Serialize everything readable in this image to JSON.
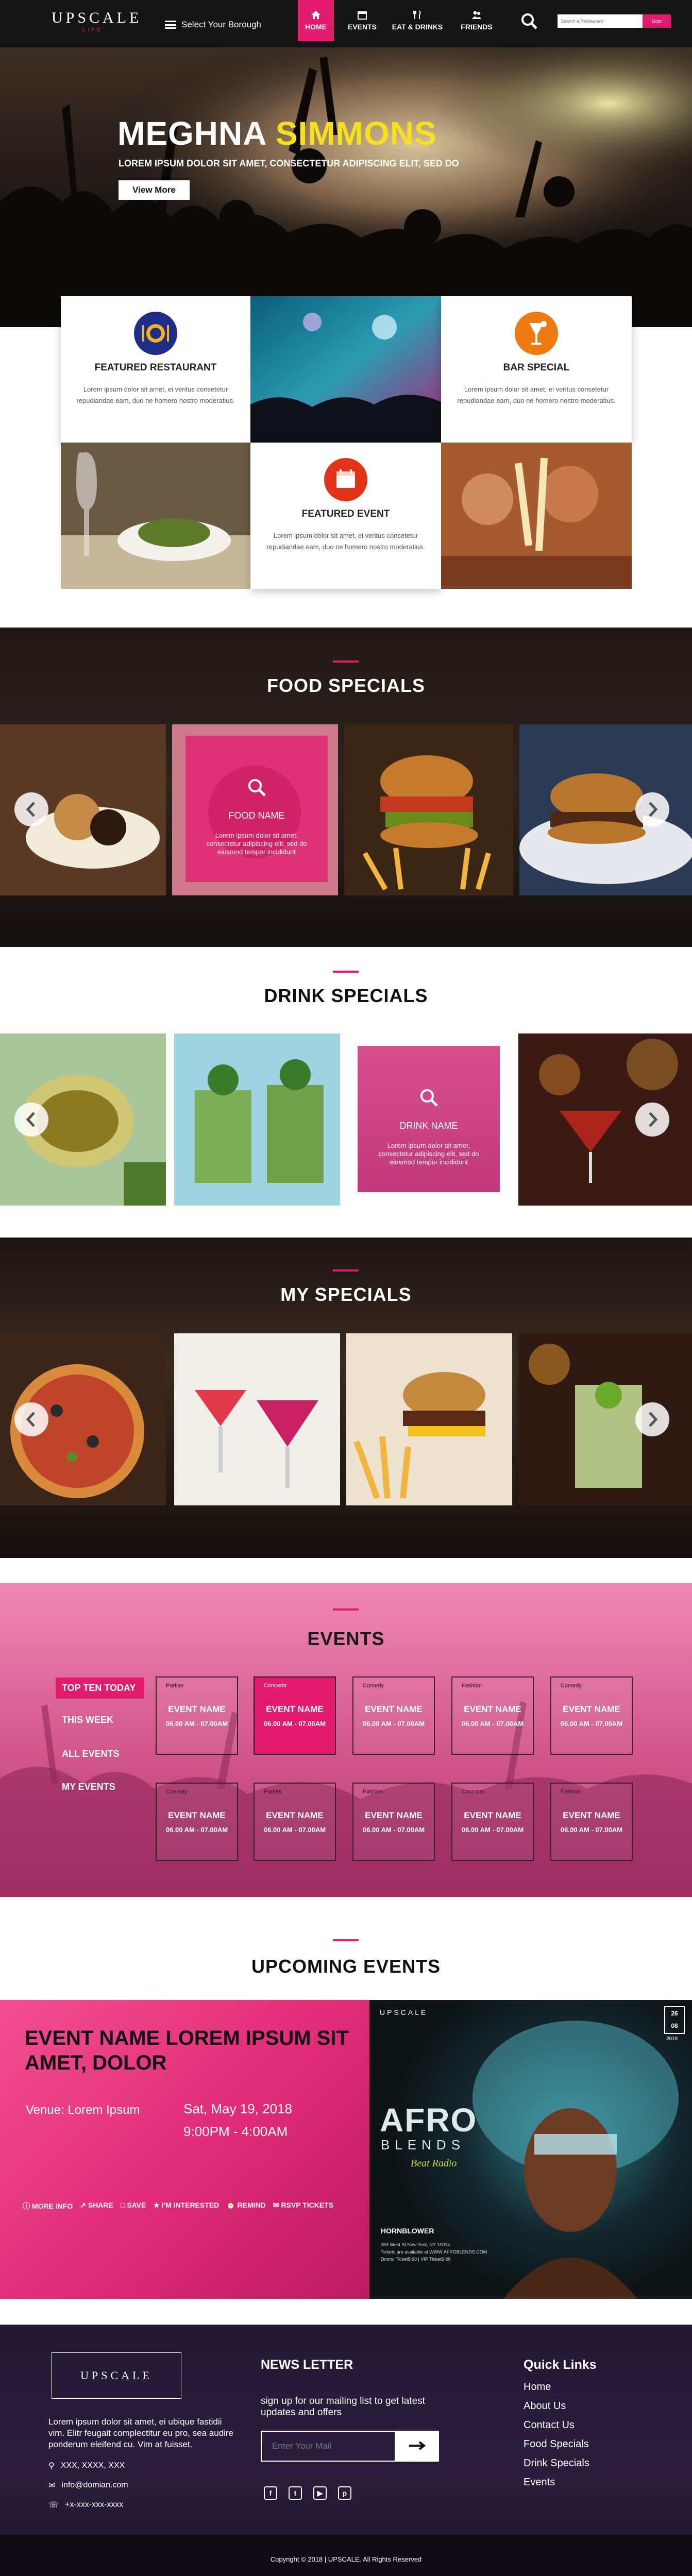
{
  "header": {
    "logo": "UPSCALE",
    "logo_sub": "LIFE",
    "borough": "Select Your Borough",
    "nav": [
      "HOME",
      "EVENTS",
      "EAT & DRINKS",
      "FRIENDS"
    ],
    "search_placeholder": "Search a Restaurant",
    "search_button": "Goto",
    "colors": {
      "accent": "#e31b6d",
      "bar": "#151515"
    }
  },
  "hero": {
    "title_white": "MEGHNA",
    "title_yellow": "SIMMONS",
    "subtitle": "LOREM IPSUM DOLOR SIT AMET, CONSECTETUR ADIPISCING ELIT, SED DO",
    "button": "View More"
  },
  "features": [
    {
      "title": "FEATURED RESTAURANT",
      "text": "Lorem ipsum dolor sit amet, ei veritus consetetur repudiandae eam, duo ne homero nostro moderatius.",
      "icon": "plate-icon",
      "color": "#1e2e8a"
    },
    {
      "title": "BAR SPECIAL",
      "text": "Lorem ipsum dolor sit amet, ei veritus consetetur repudiandae eam, duo ne homero nostro moderatius.",
      "icon": "glass-icon",
      "color": "#f07a12"
    },
    {
      "title": "FEATURED EVENT",
      "text": "Lorem ipsum dolor sit amet, ei veritus consetetur repudiandae eam, duo ne homero nostro moderatius.",
      "icon": "calendar-icon",
      "color": "#e23319"
    }
  ],
  "food": {
    "title": "FOOD SPECIALS",
    "overlay_name": "FOOD NAME",
    "overlay_text": "Lorem ipsum dolor sit amet, consectetur adipiscing elit, sed do eiusmod tempor incididunt"
  },
  "drink": {
    "title": "DRINK SPECIALS",
    "overlay_name": "DRINK NAME",
    "overlay_text": "Lorem ipsum dolor sit amet, consectetur adipiscing elit, sed do eiusmod tempor incididunt"
  },
  "my": {
    "title": "MY SPECIALS"
  },
  "events": {
    "title": "EVENTS",
    "tabs": [
      "TOP TEN TODAY",
      "THIS WEEK",
      "ALL EVENTS",
      "MY EVENTS"
    ],
    "row1_cats": [
      "Parties",
      "Concerts",
      "Comedy",
      "Fashion",
      "Comedy"
    ],
    "row2_cats": [
      "Comedy",
      "Parties",
      "Fashion",
      "Concerts",
      "Fashion"
    ],
    "card_name": "EVENT NAME",
    "card_time": "06.00 AM - 07.00AM"
  },
  "upcoming": {
    "title": "UPCOMING EVENTS",
    "event_name": "EVENT NAME LOREM IPSUM SIT AMET, DOLOR",
    "venue": "Venue: Lorem Ipsum",
    "date": "Sat, May 19, 2018",
    "time": "9:00PM - 4:00AM",
    "actions": [
      "MORE INFO",
      "SHARE",
      "SAVE",
      "I'M INTERESTED",
      "REMIND",
      "RSVP TICKETS"
    ],
    "poster": {
      "top": "UPSCALE",
      "date_day": "26",
      "date_month": "08",
      "year": "2018",
      "brand": "AFRO",
      "brand2": "BLENDS",
      "tag": "Beat Radio",
      "sponsor": "HORNBLOWER",
      "address": "353 West St New York, NY 10014",
      "tickets": "Tickets are available at WWW.AFROBLENDS.COM",
      "doors": "Doors: Ticket$ 60 | VIP Ticket$ 80"
    }
  },
  "footer": {
    "logo": "UPSCALE",
    "about": "Lorem ipsum dolor sit amet, ei ubique fastidii vim. Elitr feugait complectitur eu pro, sea audire ponderum eleifend cu. Vim at fuisset.",
    "address": "XXX, XXXX, XXX",
    "email": "info@domian.com",
    "phone": "+x-xxx-xxx-xxxx",
    "newsletter_title": "NEWS LETTER",
    "newsletter_text": "sign up for our mailing list to get latest updates and offers",
    "newsletter_placeholder": "Enter Your Mail",
    "quick_title": "Quick Links",
    "links": [
      "Home",
      "About Us",
      "Contact Us",
      "Food Specials",
      "Drink Specials",
      "Events"
    ],
    "copyright": "Copyright © 2018 | UPSCALE. All Rights Reserved"
  }
}
